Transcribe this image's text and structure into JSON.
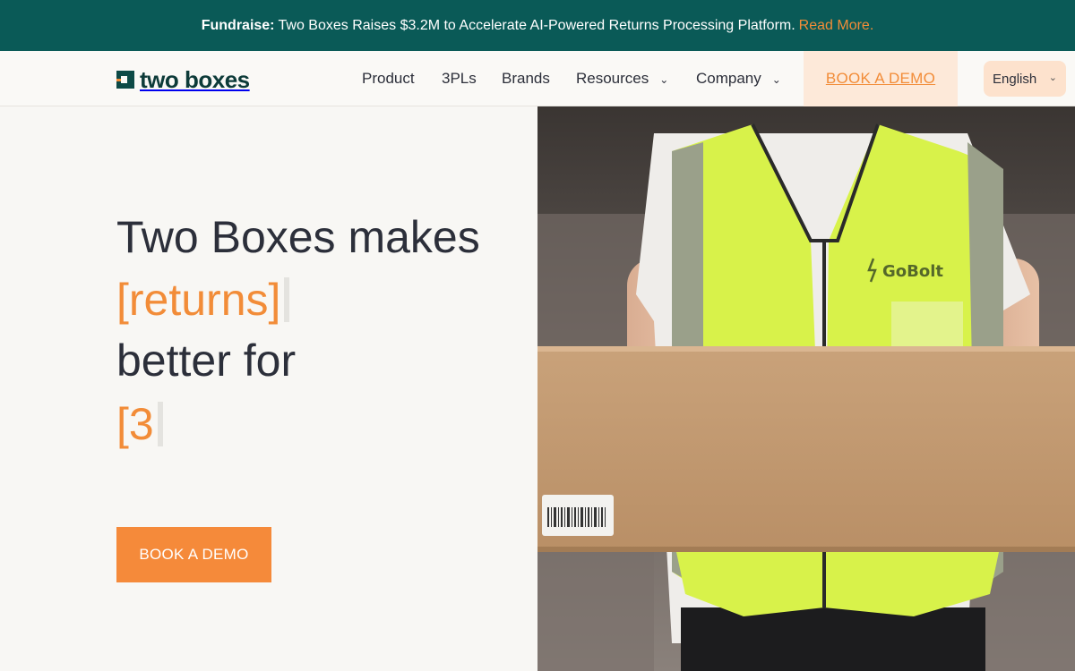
{
  "announcement": {
    "label": "Fundraise:",
    "message": "Two Boxes Raises $3.2M to Accelerate AI-Powered Returns Processing Platform.",
    "link": "Read More."
  },
  "nav": {
    "logo_text": "two boxes",
    "items": [
      {
        "label": "Product"
      },
      {
        "label": "3PLs"
      },
      {
        "label": "Brands"
      },
      {
        "label": "Resources"
      },
      {
        "label": "Company"
      }
    ],
    "cta": "BOOK A DEMO",
    "language": "English"
  },
  "hero": {
    "line1": "Two Boxes makes",
    "line2": "[returns]",
    "line3": "better for",
    "line4": "[3",
    "cta": "BOOK A DEMO",
    "vest_brand": "GoBolt"
  },
  "colors": {
    "announcement_bg": "#0a5a57",
    "accent_orange": "#f28c38",
    "vest_yellow": "#d8f24a"
  }
}
